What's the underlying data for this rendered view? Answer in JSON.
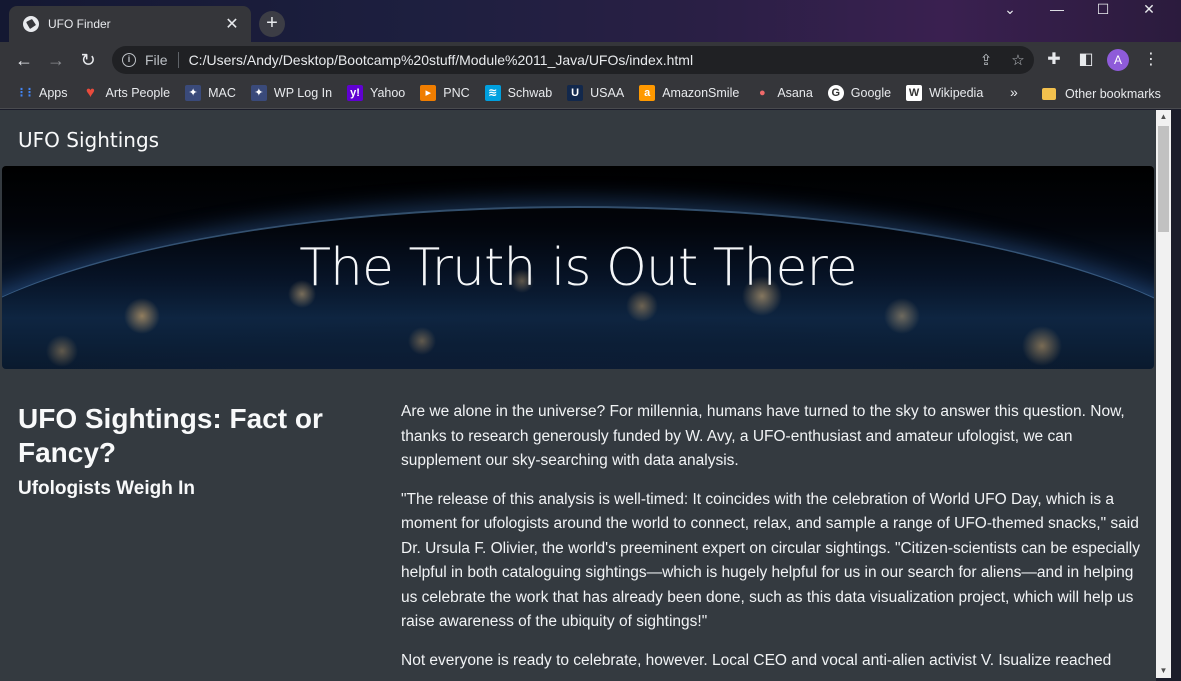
{
  "browser": {
    "tab_title": "UFO Finder",
    "tab_close": "✕",
    "new_tab": "+",
    "window_controls": {
      "minimize": "—",
      "maximize": "☐",
      "close": "✕",
      "tabsearch": "⌄"
    },
    "address": {
      "scheme": "File",
      "url": "C:/Users/Andy/Desktop/Bootcamp%20stuff/Module%2011_Java/UFOs/index.html"
    },
    "profile_initial": "A",
    "bookmarks": [
      {
        "label": "Apps",
        "icon": "apps-grid-icon",
        "color": "#4285f4"
      },
      {
        "label": "Arts People",
        "icon": "heart-icon",
        "color": "#e84b3c"
      },
      {
        "label": "MAC",
        "icon": "mac-logo-icon",
        "color": "#3a4a7a"
      },
      {
        "label": "WP Log In",
        "icon": "wp-logo-icon",
        "color": "#3a4a7a"
      },
      {
        "label": "Yahoo",
        "icon": "yahoo-icon",
        "color": "#6001d2"
      },
      {
        "label": "PNC",
        "icon": "pnc-icon",
        "color": "#ef7d00"
      },
      {
        "label": "Schwab",
        "icon": "schwab-icon",
        "color": "#00a0df"
      },
      {
        "label": "USAA",
        "icon": "usaa-icon",
        "color": "#12284c"
      },
      {
        "label": "AmazonSmile",
        "icon": "amazon-icon",
        "color": "#ff9900"
      },
      {
        "label": "Asana",
        "icon": "asana-icon",
        "color": "#f06a6a"
      },
      {
        "label": "Google",
        "icon": "google-icon",
        "color": "#ffffff"
      },
      {
        "label": "Wikipedia",
        "icon": "wikipedia-icon",
        "color": "#ffffff"
      }
    ],
    "bookmarks_overflow": "»",
    "other_bookmarks": "Other bookmarks"
  },
  "page": {
    "brand": "UFO Sightings",
    "hero_title": "The Truth is Out There",
    "article": {
      "title": "UFO Sightings: Fact or Fancy?",
      "subtitle": "Ufologists Weigh In",
      "paragraphs": [
        "Are we alone in the universe? For millennia, humans have turned to the sky to answer this question. Now, thanks to research generously funded by W. Avy, a UFO-enthusiast and amateur ufologist, we can supplement our sky-searching with data analysis.",
        "\"The release of this analysis is well-timed: It coincides with the celebration of World UFO Day, which is a moment for ufologists around the world to connect, relax, and sample a range of UFO-themed snacks,\" said Dr. Ursula F. Olivier, the world's preeminent expert on circular sightings. \"Citizen-scientists can be especially helpful in both cataloguing sightings—which is hugely helpful for us in our search for aliens—and in helping us celebrate the work that has already been done, such as this data visualization project, which will help us raise awareness of the ubiquity of sightings!\"",
        "Not everyone is ready to celebrate, however. Local CEO and vocal anti-alien activist V. Isualize reached"
      ]
    }
  }
}
